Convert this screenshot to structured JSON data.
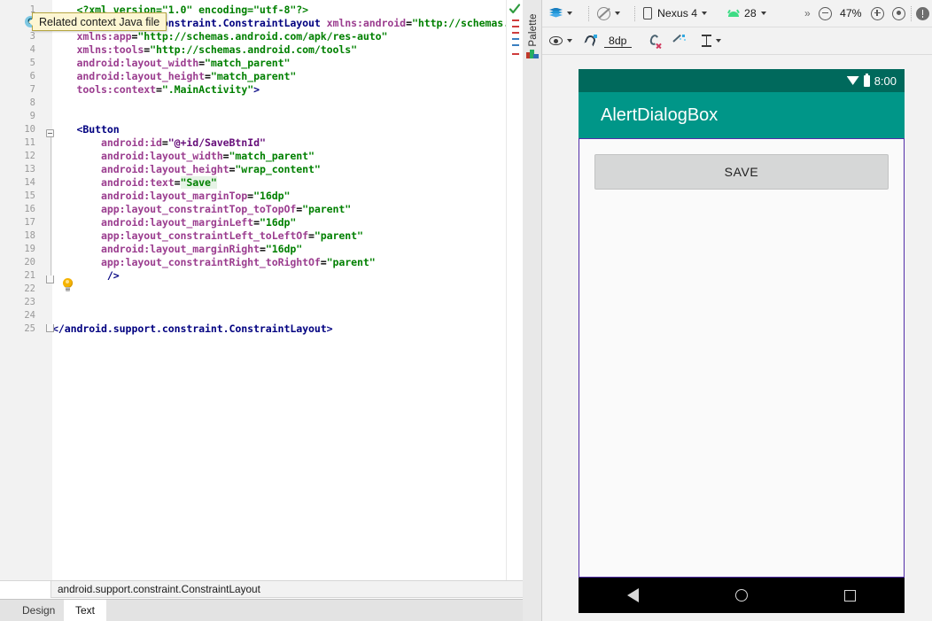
{
  "editor": {
    "tooltip": "Related context Java file",
    "gutter_marker": "C",
    "lines": [
      {
        "n": "1",
        "segs": [
          {
            "t": "    ",
            "c": "tk-plain"
          },
          {
            "t": "<?xml version=\"1.0\" encoding=\"utf-8\"?>",
            "c": "tk-pi"
          }
        ]
      },
      {
        "n": "2",
        "segs": [
          {
            "t": "<android.support.constraint.ConstraintLayout ",
            "c": "tk-tag"
          },
          {
            "t": "xmlns:android",
            "c": "tk-attr"
          },
          {
            "t": "=",
            "c": "tk-sym"
          },
          {
            "t": "\"http://schemas.",
            "c": "tk-val"
          }
        ]
      },
      {
        "n": "3",
        "segs": [
          {
            "t": "    ",
            "c": "tk-plain"
          },
          {
            "t": "xmlns:app",
            "c": "tk-attr"
          },
          {
            "t": "=",
            "c": "tk-sym"
          },
          {
            "t": "\"http://schemas.android.com/apk/res-auto\"",
            "c": "tk-val"
          }
        ]
      },
      {
        "n": "4",
        "segs": [
          {
            "t": "    ",
            "c": "tk-plain"
          },
          {
            "t": "xmlns:tools",
            "c": "tk-attr"
          },
          {
            "t": "=",
            "c": "tk-sym"
          },
          {
            "t": "\"http://schemas.android.com/tools\"",
            "c": "tk-val"
          }
        ]
      },
      {
        "n": "5",
        "segs": [
          {
            "t": "    ",
            "c": "tk-plain"
          },
          {
            "t": "android:layout_width",
            "c": "tk-attr"
          },
          {
            "t": "=",
            "c": "tk-sym"
          },
          {
            "t": "\"match_parent\"",
            "c": "tk-val"
          }
        ]
      },
      {
        "n": "6",
        "segs": [
          {
            "t": "    ",
            "c": "tk-plain"
          },
          {
            "t": "android:layout_height",
            "c": "tk-attr"
          },
          {
            "t": "=",
            "c": "tk-sym"
          },
          {
            "t": "\"match_parent\"",
            "c": "tk-val"
          }
        ]
      },
      {
        "n": "7",
        "segs": [
          {
            "t": "    ",
            "c": "tk-plain"
          },
          {
            "t": "tools:context",
            "c": "tk-attr"
          },
          {
            "t": "=",
            "c": "tk-sym"
          },
          {
            "t": "\".MainActivity\"",
            "c": "tk-val"
          },
          {
            "t": ">",
            "c": "tk-tag"
          }
        ]
      },
      {
        "n": "8",
        "segs": []
      },
      {
        "n": "9",
        "segs": []
      },
      {
        "n": "10",
        "segs": [
          {
            "t": "    ",
            "c": "tk-plain"
          },
          {
            "t": "<Button",
            "c": "tk-tag"
          }
        ]
      },
      {
        "n": "11",
        "segs": [
          {
            "t": "        ",
            "c": "tk-plain"
          },
          {
            "t": "android:id",
            "c": "tk-attr"
          },
          {
            "t": "=",
            "c": "tk-sym"
          },
          {
            "t": "\"@+id/SaveBtnId\"",
            "c": "tk-ns"
          }
        ]
      },
      {
        "n": "12",
        "segs": [
          {
            "t": "        ",
            "c": "tk-plain"
          },
          {
            "t": "android:layout_width",
            "c": "tk-attr"
          },
          {
            "t": "=",
            "c": "tk-sym"
          },
          {
            "t": "\"match_parent\"",
            "c": "tk-val"
          }
        ]
      },
      {
        "n": "13",
        "segs": [
          {
            "t": "        ",
            "c": "tk-plain"
          },
          {
            "t": "android:layout_height",
            "c": "tk-attr"
          },
          {
            "t": "=",
            "c": "tk-sym"
          },
          {
            "t": "\"wrap_content\"",
            "c": "tk-val"
          }
        ]
      },
      {
        "n": "14",
        "segs": [
          {
            "t": "        ",
            "c": "tk-plain"
          },
          {
            "t": "android:text",
            "c": "tk-attr"
          },
          {
            "t": "=",
            "c": "tk-sym"
          },
          {
            "t": "\"Save\"",
            "c": "tk-val hl-save"
          }
        ]
      },
      {
        "n": "15",
        "segs": [
          {
            "t": "        ",
            "c": "tk-plain"
          },
          {
            "t": "android:layout_marginTop",
            "c": "tk-attr"
          },
          {
            "t": "=",
            "c": "tk-sym"
          },
          {
            "t": "\"16dp\"",
            "c": "tk-val"
          }
        ]
      },
      {
        "n": "16",
        "segs": [
          {
            "t": "        ",
            "c": "tk-plain"
          },
          {
            "t": "app:layout_constraintTop_toTopOf",
            "c": "tk-attr"
          },
          {
            "t": "=",
            "c": "tk-sym"
          },
          {
            "t": "\"parent\"",
            "c": "tk-val"
          }
        ]
      },
      {
        "n": "17",
        "segs": [
          {
            "t": "        ",
            "c": "tk-plain"
          },
          {
            "t": "android:layout_marginLeft",
            "c": "tk-attr"
          },
          {
            "t": "=",
            "c": "tk-sym"
          },
          {
            "t": "\"16dp\"",
            "c": "tk-val"
          }
        ]
      },
      {
        "n": "18",
        "segs": [
          {
            "t": "        ",
            "c": "tk-plain"
          },
          {
            "t": "app:layout_constraintLeft_toLeftOf",
            "c": "tk-attr"
          },
          {
            "t": "=",
            "c": "tk-sym"
          },
          {
            "t": "\"parent\"",
            "c": "tk-val"
          }
        ]
      },
      {
        "n": "19",
        "segs": [
          {
            "t": "        ",
            "c": "tk-plain"
          },
          {
            "t": "android:layout_marginRight",
            "c": "tk-attr"
          },
          {
            "t": "=",
            "c": "tk-sym"
          },
          {
            "t": "\"16dp\"",
            "c": "tk-val"
          }
        ]
      },
      {
        "n": "20",
        "segs": [
          {
            "t": "        ",
            "c": "tk-plain"
          },
          {
            "t": "app:layout_constraintRight_toRightOf",
            "c": "tk-attr"
          },
          {
            "t": "=",
            "c": "tk-sym"
          },
          {
            "t": "\"parent\"",
            "c": "tk-val"
          }
        ]
      },
      {
        "n": "21",
        "segs": [
          {
            "t": "         ",
            "c": "tk-plain"
          },
          {
            "t": "/>",
            "c": "tk-tag"
          }
        ]
      },
      {
        "n": "22",
        "segs": []
      },
      {
        "n": "23",
        "segs": []
      },
      {
        "n": "24",
        "segs": []
      },
      {
        "n": "25",
        "segs": [
          {
            "t": "</android.support.constraint.ConstraintLayout>",
            "c": "tk-tag"
          }
        ]
      }
    ],
    "breadcrumb": "android.support.constraint.ConstraintLayout",
    "tabs": [
      {
        "label": "Design",
        "active": false
      },
      {
        "label": "Text",
        "active": true
      }
    ]
  },
  "palette": {
    "label": "Palette"
  },
  "toolbar_top": {
    "design_mode_label": "",
    "orientation_label": "",
    "device_label": "Nexus 4",
    "api_label": "28",
    "overflow_label": "»",
    "zoom_value": "47%"
  },
  "toolbar_second": {
    "margin_value": "8dp"
  },
  "preview": {
    "status_time": "8:00",
    "app_title": "AlertDialogBox",
    "save_button_label": "SAVE"
  },
  "colors": {
    "status_bar": "#00695c",
    "app_bar": "#009688",
    "selection_border": "#512da8",
    "button_fill": "#d6d7d7",
    "canvas_bg": "#f2f2f2",
    "nav_bar": "#000000"
  }
}
